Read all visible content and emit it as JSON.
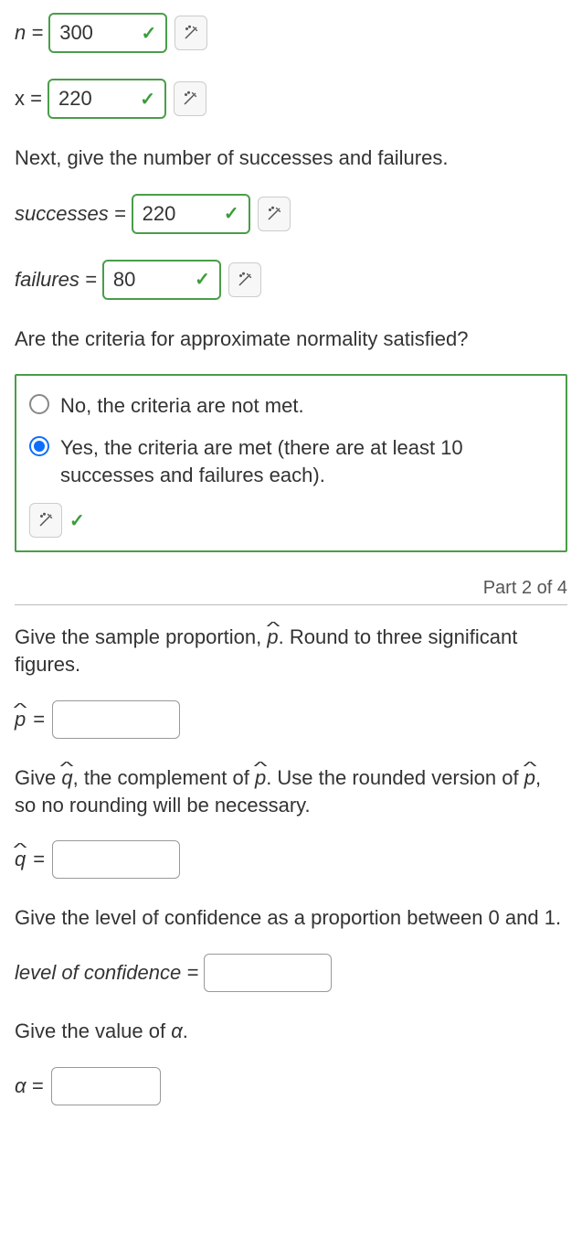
{
  "inputs": {
    "n": {
      "label": "n =",
      "value": "300"
    },
    "x": {
      "label": "x =",
      "value": "220"
    },
    "successes": {
      "label": "successes =",
      "value": "220"
    },
    "failures": {
      "label": "failures =",
      "value": "80"
    }
  },
  "prompts": {
    "successes_failures": "Next, give the number of successes and failures.",
    "normality": "Are the criteria for approximate normality satisfied?",
    "phat": "Give the sample proportion, p̂. Round to three significant figures.",
    "qhat": "Give q̂, the complement of p̂. Use the rounded version of p̂, so no rounding will be necessary.",
    "confidence": "Give the level of confidence as a proportion between 0 and 1.",
    "alpha": "Give the value of α."
  },
  "choices": {
    "no": "No, the criteria are not met.",
    "yes": "Yes, the criteria are met (there are at least 10 successes and failures each).",
    "selected": "yes"
  },
  "part_label": "Part 2 of 4",
  "labels": {
    "phat": "p",
    "qhat": "q",
    "confidence": "level of confidence =",
    "alpha": "α ="
  }
}
